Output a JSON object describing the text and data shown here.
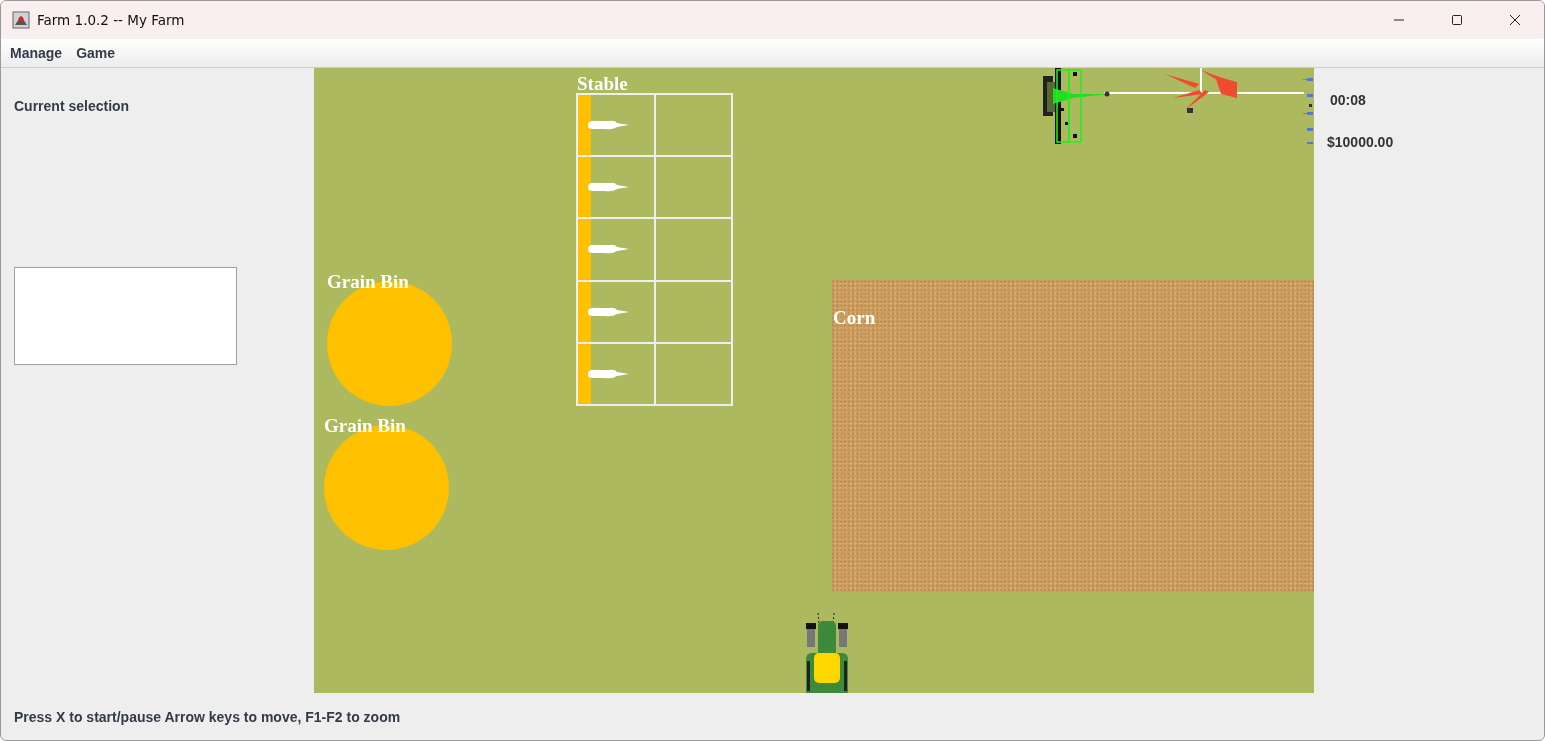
{
  "window": {
    "title": "Farm 1.0.2 -- My Farm"
  },
  "menu": [
    {
      "label": "Manage"
    },
    {
      "label": "Game"
    }
  ],
  "side_panel": {
    "heading": "Current selection"
  },
  "farm": [
    {
      "kind": "stable",
      "label": "Stable"
    },
    {
      "kind": "grain_bin",
      "label": "Grain Bin"
    },
    {
      "kind": "grain_bin",
      "label": "Grain Bin"
    },
    {
      "kind": "field",
      "label": "Corn"
    }
  ],
  "info": {
    "time": "00:08",
    "money": "$10000.00"
  },
  "status_bar": "Press X to start/pause Arrow keys to move, F1-F2 to zoom"
}
